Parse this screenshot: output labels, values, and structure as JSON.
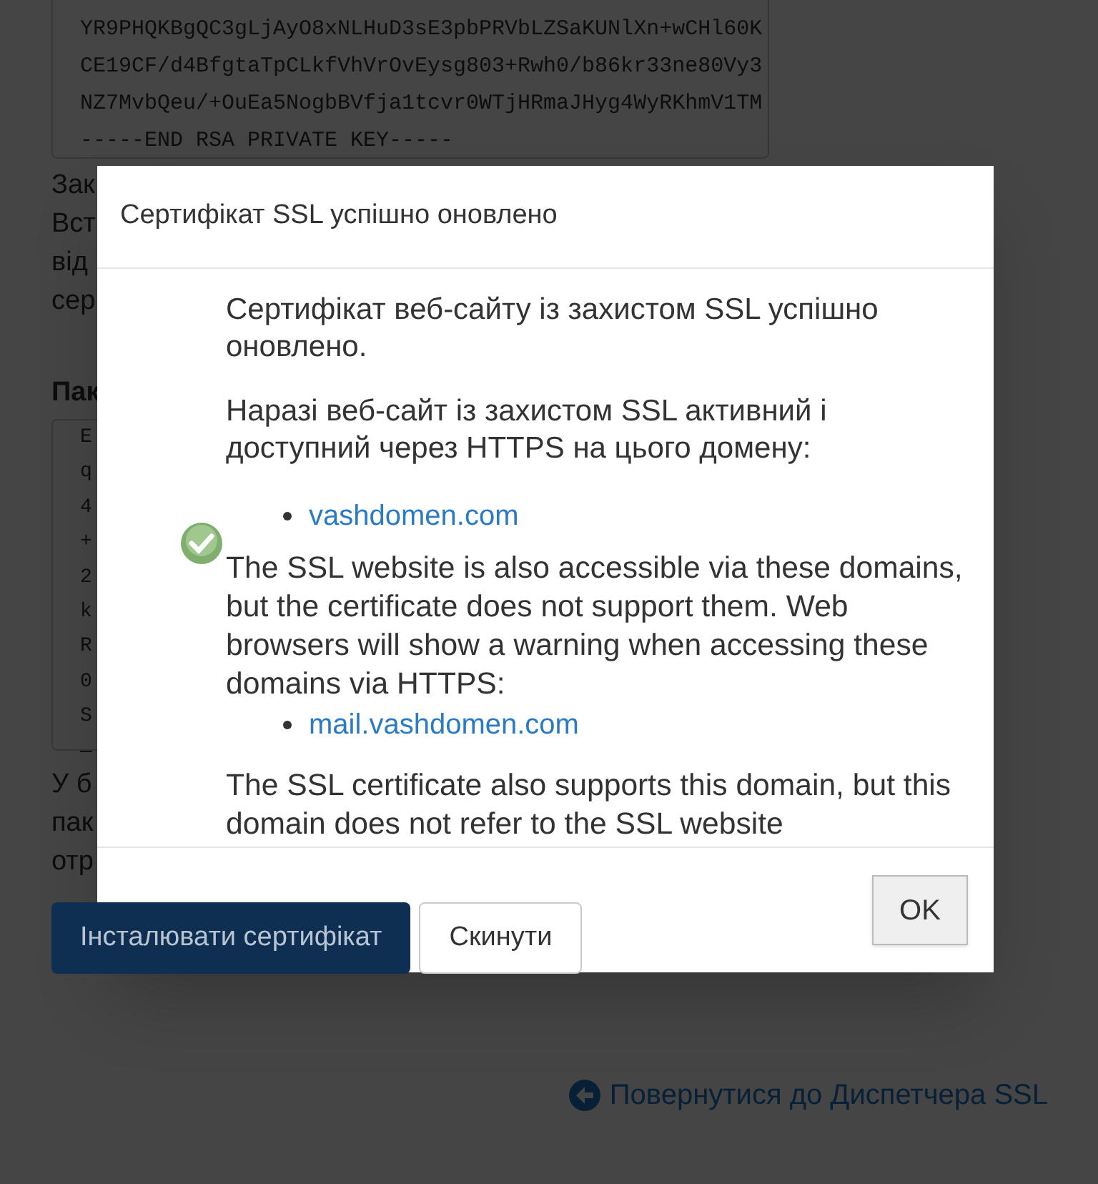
{
  "page": {
    "key_textarea": {
      "lines": [
        "YR9PHQKBgQC3gLjAyO8xNLHuD3sE3pbPRVbLZSaKUNlXn+wCHl60K",
        "CE19CF/d4BfgtaTpCLkfVhVrOvEysg803+Rwh0/b86kr33ne80Vy3",
        "NZ7MvbQeu/+OuEa5NogbBVfja1tcvr0WTjHRmaJHyg4WyRKhmV1TM",
        "-----END RSA PRIVATE KEY-----"
      ]
    },
    "text_fragments_1": [
      "Зак",
      "Вст",
      "від",
      "сер"
    ],
    "section_heading": "Пак",
    "cert_textarea": {
      "lines": [
        "E",
        "q",
        "4",
        "+",
        "2",
        "k",
        "R",
        "0",
        "S",
        "—"
      ]
    },
    "text_fragments_2": [
      "У б",
      "пак",
      "отр"
    ],
    "buttons": [
      {
        "label": "Інсталювати сертифікат",
        "kind": "primary"
      },
      {
        "label": "Скинути",
        "kind": "default"
      }
    ],
    "back_link": "Повернутися до Диспетчера SSL"
  },
  "dialog": {
    "title": "Сертифікат SSL успішно оновлено",
    "body": [
      {
        "kind": "text",
        "text": "Сертифікат веб-сайту із захистом SSL успішно оновлено."
      },
      {
        "kind": "text",
        "text": "Наразі веб-сайт із захистом SSL активний і доступний через HTTPS на цього домену:"
      },
      {
        "kind": "list",
        "items": [
          "vashdomen.com"
        ]
      },
      {
        "kind": "detail",
        "text": "The SSL website is also accessible via these domains, but the certificate does not support them. Web browsers will show a warning when accessing these domains via HTTPS:"
      },
      {
        "kind": "list",
        "items": [
          "mail.vashdomen.com"
        ]
      },
      {
        "kind": "detail",
        "text": "The SSL certificate also supports this domain, but this domain does not refer to the SSL website"
      }
    ],
    "button": "OK"
  }
}
